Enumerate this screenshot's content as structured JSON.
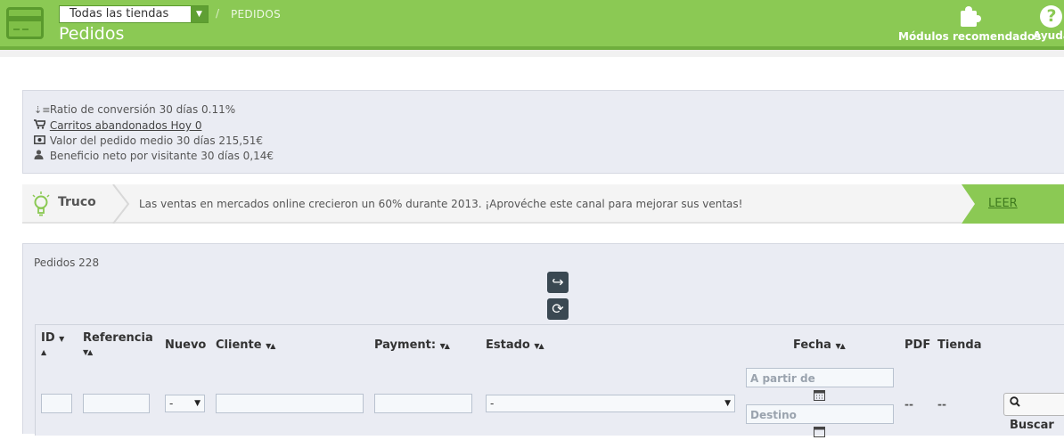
{
  "header": {
    "shop_selector": "Todas las tiendas",
    "breadcrumb": "PEDIDOS",
    "breadcrumb_sep": "/",
    "title": "Pedidos",
    "modules_label": "Módulos recomendados",
    "help_label": "Ayuda",
    "help_glyph": "?",
    "accent_color": "#8bc954"
  },
  "kpis": [
    {
      "icon": "sort-desc-icon",
      "text": "Ratio de conversión 30 días 0.11%"
    },
    {
      "icon": "cart-icon",
      "text": "Carritos abandonados Hoy 0"
    },
    {
      "icon": "money-icon",
      "text": "Valor del pedido medio 30 días 215,51€"
    },
    {
      "icon": "user-icon",
      "text": "Beneficio neto por visitante 30 días 0,14€"
    }
  ],
  "tip": {
    "label": "Truco",
    "text": "Las ventas en mercados online crecieron un 60% durante 2013. ¡Aprovéche este canal para mejorar sus ventas!",
    "read_label": "LEER"
  },
  "orders": {
    "title": "Pedidos 228",
    "columns": {
      "id": "ID",
      "reference": "Referencia",
      "new": "Nuevo",
      "customer": "Cliente",
      "payment": "Payment:",
      "status": "Estado",
      "date": "Fecha",
      "pdf": "PDF",
      "shop": "Tienda"
    },
    "filters": {
      "new_value": "-",
      "status_value": "-",
      "date_from_placeholder": "A partir de",
      "date_to_placeholder": "Destino",
      "pdf_value": "--",
      "shop_value": "--",
      "search_label": "Buscar"
    }
  }
}
